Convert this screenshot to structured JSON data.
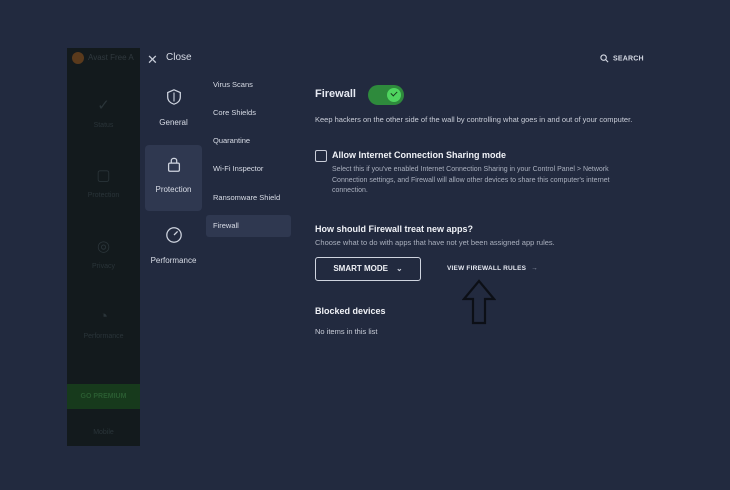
{
  "background_app": {
    "logo_text": "Avast Free A",
    "nav": [
      "Status",
      "Protection",
      "Privacy",
      "Performance"
    ],
    "premium_label": "GO PREMIUM",
    "mobile_label": "Mobile"
  },
  "header": {
    "close_label": "Close",
    "search_label": "SEARCH"
  },
  "categories": [
    {
      "label": "General",
      "icon": "shield-icon"
    },
    {
      "label": "Protection",
      "icon": "lock-icon",
      "active": true
    },
    {
      "label": "Performance",
      "icon": "gauge-icon"
    }
  ],
  "subnav": [
    {
      "label": "Virus Scans"
    },
    {
      "label": "Core Shields"
    },
    {
      "label": "Quarantine"
    },
    {
      "label": "Wi-Fi Inspector"
    },
    {
      "label": "Ransomware Shield"
    },
    {
      "label": "Firewall",
      "active": true
    }
  ],
  "firewall": {
    "title": "Firewall",
    "enabled": true,
    "description": "Keep hackers on the other side of the wall by controlling what goes in and out of your computer.",
    "ics_label": "Allow Internet Connection Sharing mode",
    "ics_checked": false,
    "ics_description": "Select this if you've enabled Internet Connection Sharing in your Control Panel > Network Connection settings, and Firewall will allow other devices to share this computer's internet connection.",
    "new_apps_title": "How should Firewall treat new apps?",
    "new_apps_subtitle": "Choose what to do with apps that have not yet been assigned app rules.",
    "mode_value": "SMART MODE",
    "view_rules_label": "VIEW FIREWALL RULES",
    "blocked_title": "Blocked devices",
    "blocked_empty": "No items in this list"
  },
  "colors": {
    "background": "#222a3f",
    "active_item": "#2f3850",
    "toggle_on": "#4fd45f"
  }
}
